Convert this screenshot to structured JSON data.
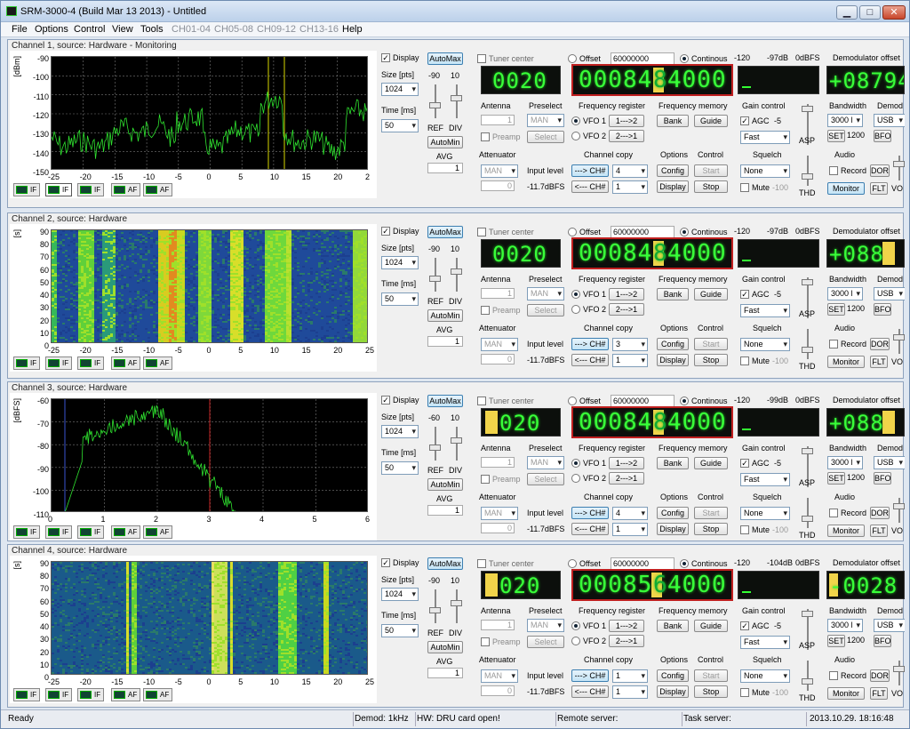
{
  "window": {
    "title": "SRM-3000-4   (Build Mar 13 2013) - Untitled"
  },
  "menu": [
    "File",
    "Options",
    "Control",
    "View",
    "Tools",
    "CH01-04",
    "CH05-08",
    "CH09-12",
    "CH13-16",
    "Help"
  ],
  "channels": [
    {
      "title": "Channel 1, source: Hardware - Monitoring",
      "type": "spectrum",
      "yunit": "[dBm]",
      "yticks": [
        "-90",
        "-100",
        "-110",
        "-120",
        "-130",
        "-140",
        "-150"
      ],
      "xticks": [
        "-25",
        "-20",
        "-15",
        "-10",
        "-5",
        "0",
        "5",
        "10",
        "15",
        "20",
        "2"
      ],
      "ref": "-90",
      "div": "10",
      "size": "1024",
      "time": "50",
      "lcd1": "0020",
      "lcd2": "00084",
      "lcd2b": "8",
      "lcd2c": "4000",
      "meter_lo": "-120",
      "meter_val": "-97dB",
      "meter_hi": "0dBFS",
      "demod_lcd": "+08794",
      "ccn": "4",
      "ccn2": "1",
      "bw": "3000 l",
      "bw_set": "1200",
      "mode": "USB"
    },
    {
      "title": "Channel 2, source: Hardware",
      "type": "waterfall",
      "yunit": "[s]",
      "yticks": [
        "90",
        "80",
        "70",
        "60",
        "50",
        "40",
        "30",
        "20",
        "10",
        "0"
      ],
      "xticks": [
        "-25",
        "-20",
        "-15",
        "-10",
        "-5",
        "0",
        "5",
        "10",
        "15",
        "20",
        "25"
      ],
      "ref": "-90",
      "div": "10",
      "size": "1024",
      "time": "50",
      "lcd1": "0020",
      "lcd2": "00084",
      "lcd2b": "8",
      "lcd2c": "4000",
      "meter_lo": "-120",
      "meter_val": "-97dB",
      "meter_hi": "0dBFS",
      "demod_lcd": "+088",
      "ccn": "3",
      "ccn2": "1",
      "bw": "3000 l",
      "bw_set": "1200",
      "mode": "USB"
    },
    {
      "title": "Channel 3, source: Hardware",
      "type": "spectrum2",
      "yunit": "[dBFS]",
      "yticks": [
        "-60",
        "-70",
        "-80",
        "-90",
        "-100",
        "-110"
      ],
      "xticks": [
        "0",
        "1",
        "2",
        "3",
        "4",
        "5",
        "6"
      ],
      "ref": "-60",
      "div": "10",
      "size": "1024",
      "time": "50",
      "lcd1": "020",
      "lcd2": "00084",
      "lcd2b": "8",
      "lcd2c": "4000",
      "meter_lo": "-120",
      "meter_val": "-99dB",
      "meter_hi": "0dBFS",
      "demod_lcd": "+088",
      "ccn": "4",
      "ccn2": "1",
      "bw": "3000 l",
      "bw_set": "1200",
      "mode": "USB"
    },
    {
      "title": "Channel 4, source: Hardware",
      "type": "waterfall2",
      "yunit": "[s]",
      "yticks": [
        "90",
        "80",
        "70",
        "60",
        "50",
        "40",
        "30",
        "20",
        "10",
        "0"
      ],
      "xticks": [
        "-25",
        "-20",
        "-15",
        "-10",
        "-5",
        "0",
        "5",
        "10",
        "15",
        "20",
        "25"
      ],
      "ref": "-90",
      "div": "10",
      "size": "1024",
      "time": "50",
      "lcd1": "020",
      "lcd2": "00085",
      "lcd2b": "6",
      "lcd2c": "4000",
      "meter_lo": "-120",
      "meter_val": "-104dB",
      "meter_hi": "0dBFS",
      "demod_lcd": "-0028",
      "ccn": "1",
      "ccn2": "1",
      "bw": "3000 l",
      "bw_set": "1200",
      "mode": "USB"
    }
  ],
  "labels": {
    "display": "Display",
    "automax": "AutoMax",
    "automin": "AutoMin",
    "size": "Size [pts]",
    "time": "Time [ms]",
    "ref": "REF",
    "div": "DIV",
    "avg": "AVG",
    "avgval": "1",
    "tuner": "Tuner center",
    "offset": "Offset",
    "offset_val": "60000000",
    "continous": "Continous",
    "demod_offset": "Demodulator offset",
    "antenna": "Antenna",
    "preselect": "Preselect",
    "freq_reg": "Frequency register",
    "freq_mem": "Frequency memory",
    "gain": "Gain control",
    "bandwidth": "Bandwidth",
    "demod": "Demod",
    "preamp": "Preamp",
    "select": "Select",
    "man": "MAN",
    "vfo1": "VFO 1",
    "vfo2": "VFO 2",
    "b12": "1--->2",
    "b21": "2--->1",
    "bank": "Bank",
    "guide": "Guide",
    "agc": "AGC",
    "agcval": "-5",
    "fast": "Fast",
    "set": "SET",
    "bfo": "BFO",
    "asp": "ASP",
    "attenuator": "Attenuator",
    "input_level": "Input level",
    "input_val": "-11.7dBFS",
    "channel_copy": "Channel copy",
    "to_ch": "---> CH#",
    "from_ch": "<--- CH#",
    "options": "Options",
    "control": "Control",
    "config": "Config",
    "start": "Start",
    "display_btn": "Display",
    "stop": "Stop",
    "squelch": "Squelch",
    "none": "None",
    "mute": "Mute",
    "mute_val": "-100",
    "audio": "Audio",
    "record": "Record",
    "monitor": "Monitor",
    "dor": "DOR",
    "flt": "FLT",
    "vo": "VO",
    "thd": "THD",
    "ant_val": "1",
    "att_val": "0",
    "btn_if": "IF",
    "btn_af": "AF"
  },
  "status": {
    "ready": "Ready",
    "demod": "Demod: 1kHz",
    "hw": "HW: DRU card open!",
    "remote": "Remote server:",
    "task": "Task server:",
    "datetime": "2013.10.29. 18:16:48"
  }
}
